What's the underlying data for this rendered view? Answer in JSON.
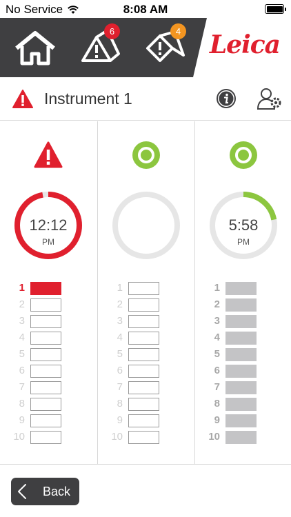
{
  "status_bar": {
    "carrier": "No Service",
    "time": "8:08 AM"
  },
  "nav": {
    "home_icon": "home-icon",
    "alarms_badge": "6",
    "warnings_badge": "4",
    "logo_text": "Leica",
    "colors": {
      "dark": "#3f3f41",
      "red": "#e0202e",
      "orange": "#f39521"
    }
  },
  "title_row": {
    "title": "Instrument 1",
    "warn_icon": "warning-icon",
    "info_icon": "info-icon",
    "user_settings_icon": "user-settings-icon"
  },
  "columns": [
    {
      "status": "error",
      "time": "12:12",
      "ampm": "PM",
      "progress": 0.97,
      "ring_color": "#e0202e",
      "slots": [
        "1",
        "2",
        "3",
        "4",
        "5",
        "6",
        "7",
        "8",
        "9",
        "10"
      ],
      "slot_state": "first-active"
    },
    {
      "status": "ok",
      "time": "",
      "ampm": "",
      "progress": 0,
      "ring_color": "#e6e6e6",
      "slots": [
        "1",
        "2",
        "3",
        "4",
        "5",
        "6",
        "7",
        "8",
        "9",
        "10"
      ],
      "slot_state": "empty"
    },
    {
      "status": "ok",
      "time": "5:58",
      "ampm": "PM",
      "progress": 0.22,
      "ring_color": "#8cc63f",
      "slots": [
        "1",
        "2",
        "3",
        "4",
        "5",
        "6",
        "7",
        "8",
        "9",
        "10"
      ],
      "slot_state": "filled"
    }
  ],
  "footer": {
    "back_label": "Back"
  }
}
